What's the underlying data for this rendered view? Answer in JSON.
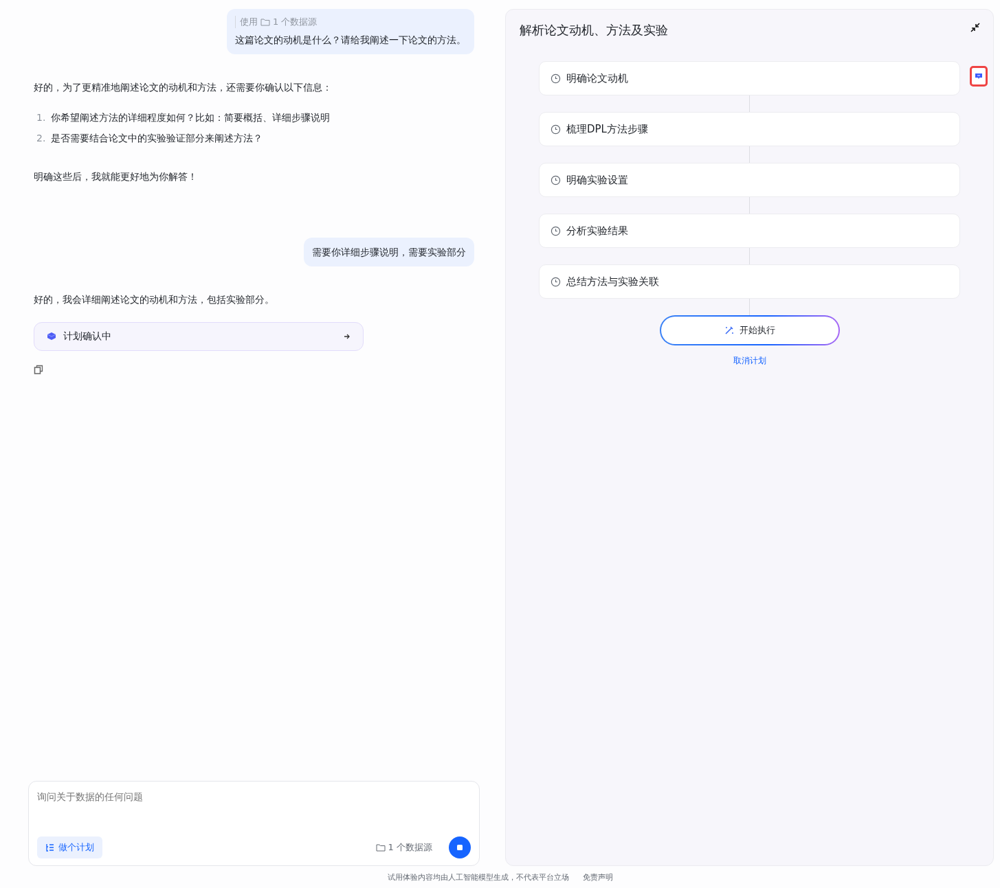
{
  "chat": {
    "messages": [
      {
        "kind": "user",
        "source_prefix": "使用",
        "source_label": "1 个数据源",
        "text": "这篇论文的动机是什么？请给我阐述一下论文的方法。"
      },
      {
        "kind": "assistant",
        "intro": "好的，为了更精准地阐述论文的动机和方法，还需要你确认以下信息：",
        "list": [
          {
            "number": "1.",
            "text": "你希望阐述方法的详细程度如何？比如：简要概括、详细步骤说明"
          },
          {
            "number": "2.",
            "text": "是否需要结合论文中的实验验证部分来阐述方法？"
          }
        ],
        "outro": "明确这些后，我就能更好地为你解答！"
      },
      {
        "kind": "user",
        "text": "需要你详细步骤说明，需要实验部分"
      },
      {
        "kind": "assistant",
        "intro": "好的，我会详细阐述论文的动机和方法，包括实验部分。",
        "plan_card": "计划确认中",
        "copy": true
      }
    ]
  },
  "composer": {
    "placeholder": "询问关于数据的任何问题",
    "plan_button": "做个计划",
    "source_label": "1 个数据源"
  },
  "footer": {
    "notice": "试用体验内容均由人工智能模型生成，不代表平台立场",
    "disclaimer": "免责声明"
  },
  "plan_panel": {
    "title": "解析论文动机、方法及实验",
    "steps": [
      "明确论文动机",
      "梳理DPL方法步骤",
      "明确实验设置",
      "分析实验结果",
      "总结方法与实验关联"
    ],
    "start_button": "开始执行",
    "cancel_link": "取消计划"
  }
}
